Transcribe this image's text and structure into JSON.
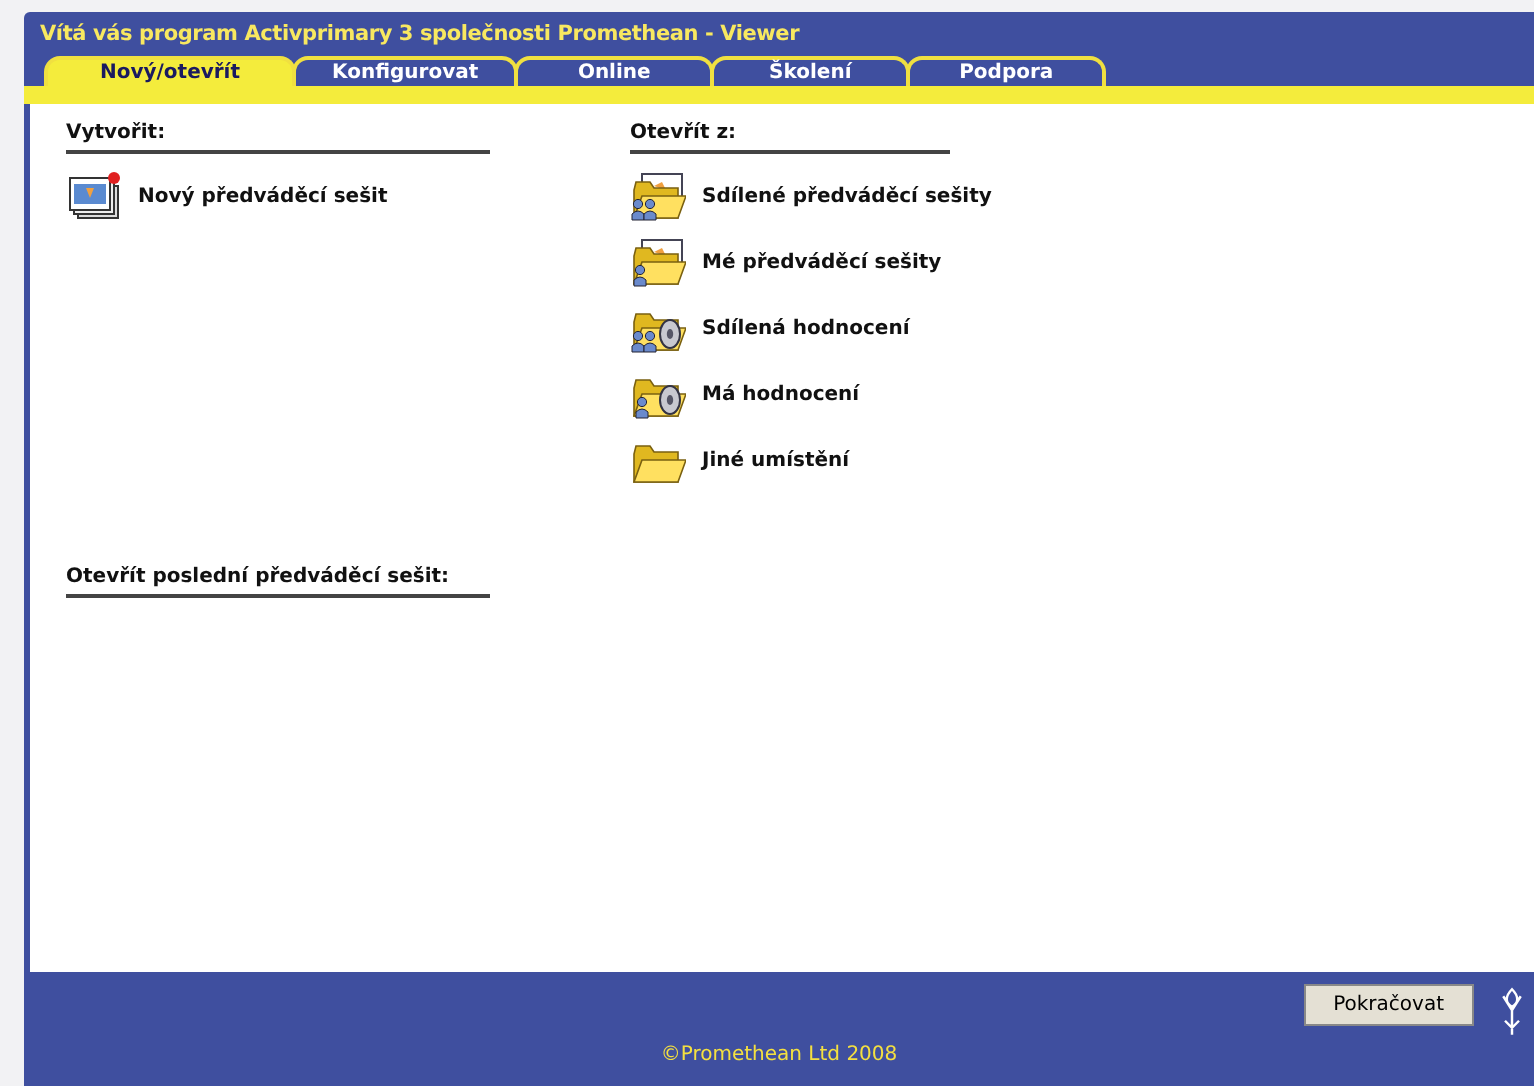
{
  "window": {
    "title": "Vítá vás program Activprimary 3 společnosti Promethean - Viewer"
  },
  "tabs": [
    {
      "label": "Nový/otevřít",
      "selected": true
    },
    {
      "label": "Konfigurovat",
      "selected": false
    },
    {
      "label": "Online",
      "selected": false
    },
    {
      "label": "Školení",
      "selected": false
    },
    {
      "label": "Podpora",
      "selected": false
    }
  ],
  "create": {
    "heading": "Vytvořit:",
    "items": [
      {
        "label": "Nový předváděcí sešit",
        "kind": "new-flipchart"
      }
    ]
  },
  "open_from": {
    "heading": "Otevřít z:",
    "items": [
      {
        "label": "Sdílené předváděcí sešity",
        "kind": "shared-flipcharts"
      },
      {
        "label": "Mé předváděcí sešity",
        "kind": "my-flipcharts"
      },
      {
        "label": "Sdílená hodnocení",
        "kind": "shared-assessments"
      },
      {
        "label": "Má hodnocení",
        "kind": "my-assessments"
      },
      {
        "label": "Jiné umístění",
        "kind": "folder"
      }
    ]
  },
  "recent": {
    "heading": "Otevřít poslední předváděcí sešit:"
  },
  "continue_button": "Pokračovat",
  "copyright": "©Promethean Ltd 2008"
}
